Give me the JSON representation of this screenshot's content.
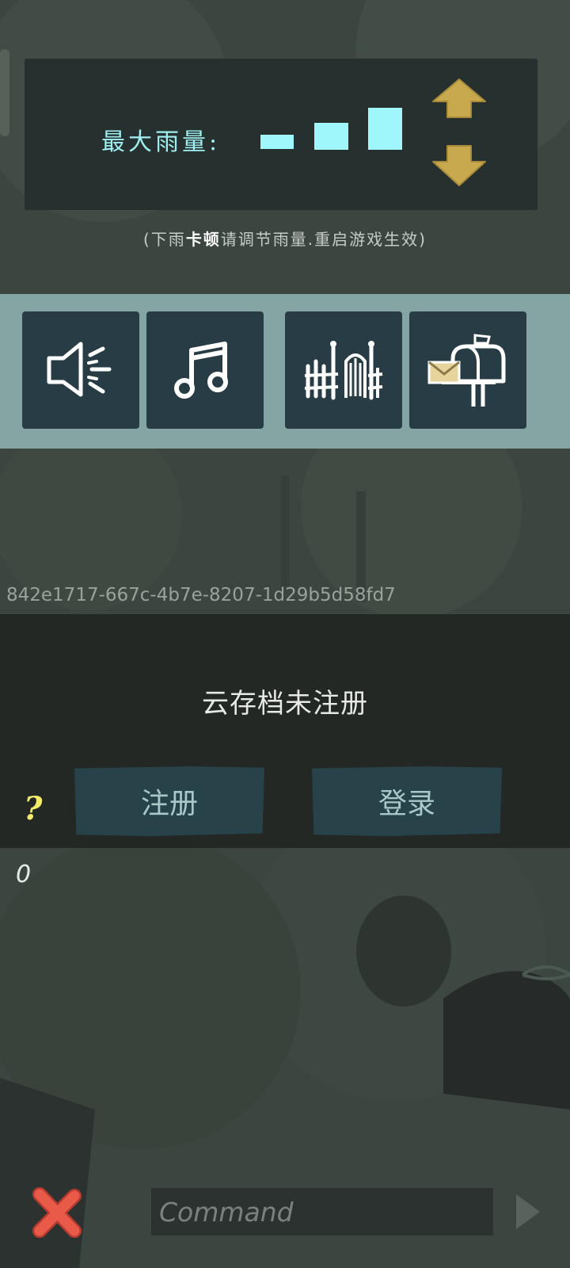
{
  "rain": {
    "label": "最大雨量:",
    "bars_total": 3,
    "selected_level": 3,
    "hint_prefix": "(下雨",
    "hint_emphasis": "卡顿",
    "hint_suffix": "请调节雨量.重启游戏生效)"
  },
  "icons": [
    "sound-icon",
    "music-icon",
    "fence-gate-icon",
    "mailbox-icon"
  ],
  "device_id": "842e1717-667c-4b7e-8207-1d29b5d58fd7",
  "cloud": {
    "title": "云存档未注册",
    "register_label": "注册",
    "login_label": "登录",
    "help_label": "?"
  },
  "counter": "0",
  "command": {
    "placeholder": "Command",
    "value": ""
  },
  "colors": {
    "accent_cyan": "#9ff7fb",
    "arrow_gold": "#c8a94e",
    "strip": "#85a4a4",
    "tile": "#273c44",
    "button": "#284249",
    "close_red": "#ea5a48"
  }
}
